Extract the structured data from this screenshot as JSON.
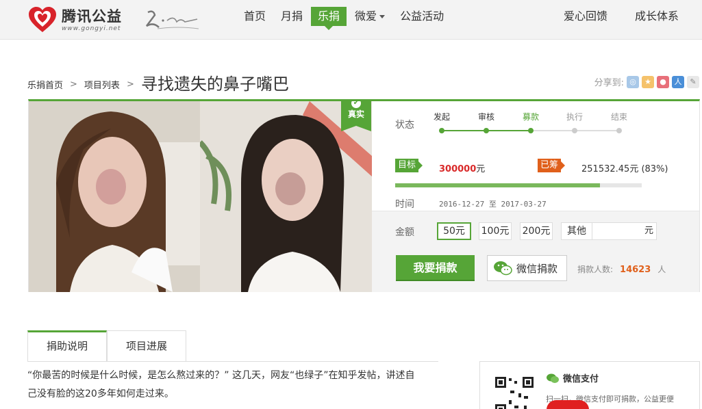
{
  "header": {
    "logo_main": "腾讯公益",
    "logo_url": "www.gongyi.net",
    "slogan": "乐·在一起",
    "nav": [
      {
        "label": "首页",
        "active": false
      },
      {
        "label": "月捐",
        "active": false
      },
      {
        "label": "乐捐",
        "active": true
      },
      {
        "label": "微爱",
        "active": false,
        "dropdown": true
      },
      {
        "label": "公益活动",
        "active": false
      }
    ],
    "nav_right": [
      "爱心回馈",
      "成长体系"
    ]
  },
  "breadcrumb": {
    "home": "乐捐首页",
    "list": "项目列表",
    "sep": ">"
  },
  "title": "寻找遗失的鼻子嘴巴",
  "share": {
    "label": "分享到:",
    "icons": [
      "qzone-icon",
      "qq-icon",
      "weibo-icon",
      "renren-icon",
      "kaixin-icon"
    ]
  },
  "project": {
    "verified": "真实",
    "status_label": "状态",
    "steps": [
      {
        "label": "发起",
        "state": "done"
      },
      {
        "label": "审核",
        "state": "done"
      },
      {
        "label": "募款",
        "state": "current"
      },
      {
        "label": "执行",
        "state": "todo"
      },
      {
        "label": "结束",
        "state": "todo"
      }
    ],
    "target_label": "目标",
    "target_value": "300000",
    "target_unit": "元",
    "raised_label": "已筹",
    "raised_value": "251532.45",
    "raised_unit": "元",
    "raised_pct": "(83%)",
    "progress": 0.83,
    "time_label": "时间",
    "start_date": "2016-12-27",
    "to": "至",
    "end_date": "2017-03-27",
    "amount_label": "金额",
    "amounts": [
      "50元",
      "100元",
      "200元"
    ],
    "other_label": "其他",
    "other_unit": "元",
    "donate_button": "我要捐款",
    "wechat_button": "微信捐款",
    "donors_label": "捐款人数:",
    "donors_count": "14623",
    "donors_unit": "人"
  },
  "tabs": [
    "捐助说明",
    "项目进展"
  ],
  "description": [
    "“你最苦的时候是什么时候，是怎么熬过来的？” 这几天，网友“也绿子”在知乎发帖，讲述自",
    "己没有脸的这20多年如何走过来。"
  ],
  "wechat_pay": {
    "title": "微信支付",
    "text": "扫一扫，微信支付即可捐款，公益更便"
  },
  "colors": {
    "brand_green": "#56a537",
    "accent_orange": "#e0601b",
    "red": "#d92a2a"
  }
}
